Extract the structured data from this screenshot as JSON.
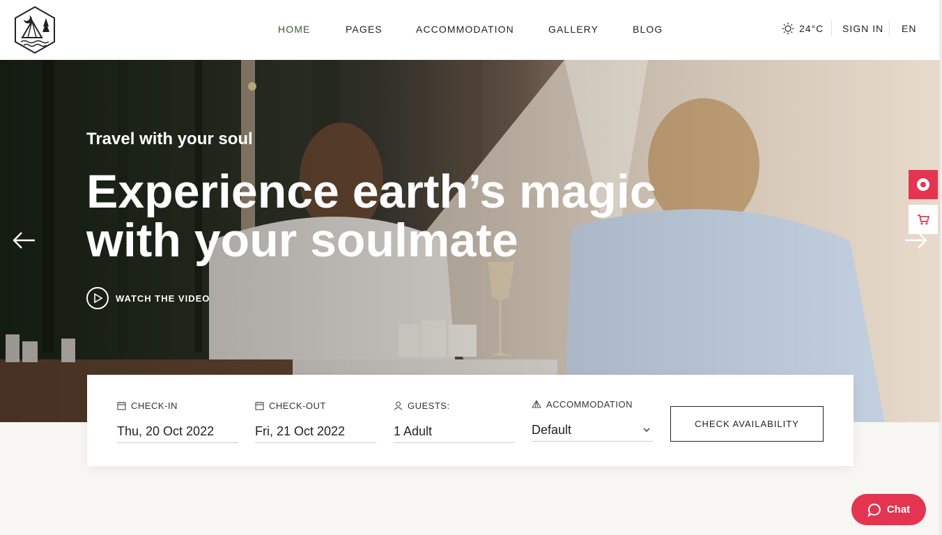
{
  "header": {
    "logo_icon": "camp-tent-moon-logo",
    "nav": [
      {
        "label": "HOME",
        "active": true
      },
      {
        "label": "PAGES",
        "active": false
      },
      {
        "label": "ACCOMMODATION",
        "active": false
      },
      {
        "label": "GALLERY",
        "active": false
      },
      {
        "label": "BLOG",
        "active": false
      }
    ],
    "weather": {
      "icon": "sun-icon",
      "temperature": "24°C"
    },
    "sign_in": "SIGN IN",
    "language": "EN"
  },
  "hero": {
    "subtitle": "Travel with your soul",
    "title_line1": "Experience earth’s magic",
    "title_line2": "with your soulmate",
    "watch_video": "WATCH THE VIDEO",
    "prev_icon": "arrow-left-icon",
    "next_icon": "arrow-right-icon"
  },
  "side_buttons": [
    {
      "icon": "lifebuoy-icon",
      "color": "#e5344f"
    },
    {
      "icon": "cart-icon",
      "color": "#e5344f"
    }
  ],
  "booking": {
    "check_in": {
      "label": "CHECK-IN",
      "value": "Thu, 20 Oct 2022",
      "icon": "calendar-icon"
    },
    "check_out": {
      "label": "CHECK-OUT",
      "value": "Fri, 21 Oct 2022",
      "icon": "calendar-icon"
    },
    "guests": {
      "label": "GUESTS:",
      "value": "1 Adult",
      "icon": "user-icon"
    },
    "accommodation": {
      "label": "ACCOMMODATION",
      "value": "Default",
      "icon": "tent-icon"
    },
    "button": "CHECK AVAILABILITY"
  },
  "chat": {
    "label": "Chat",
    "color": "#e5344f"
  },
  "colors": {
    "accent": "#e5344f",
    "nav_active": "#3c5a2e"
  }
}
